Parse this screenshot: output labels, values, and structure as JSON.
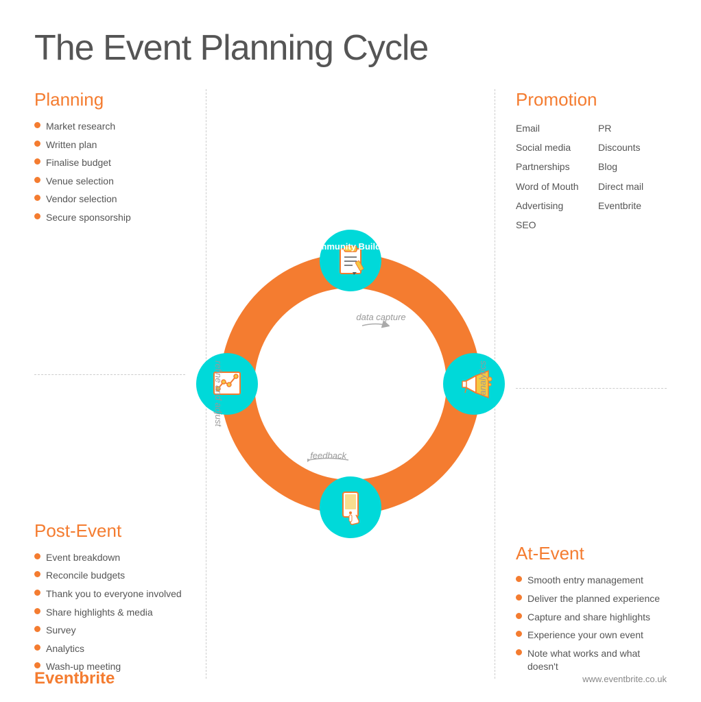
{
  "title": "The Event Planning Cycle",
  "planning": {
    "label": "Planning",
    "items": [
      "Market research",
      "Written plan",
      "Finalise budget",
      "Venue selection",
      "Vendor selection",
      "Secure sponsorship"
    ]
  },
  "post_event": {
    "label": "Post-Event",
    "items": [
      "Event breakdown",
      "Reconcile budgets",
      "Thank you to everyone involved",
      "Share highlights & media",
      "Survey",
      "Analytics",
      "Wash-up meeting"
    ]
  },
  "promotion": {
    "label": "Promotion",
    "col1": [
      "Email",
      "Social media",
      "Partnerships",
      "Word of Mouth",
      "Advertising",
      "SEO"
    ],
    "col2": [
      "PR",
      "Discounts",
      "Blog",
      "Direct mail",
      "Eventbrite",
      ""
    ]
  },
  "at_event": {
    "label": "At-Event",
    "items": [
      "Smooth entry management",
      "Deliver the planned experience",
      "Capture and share highlights",
      "Experience your own event",
      "Note what works and what doesn't"
    ]
  },
  "cycle": {
    "community_building": "Community Building",
    "data_capture": "data capture",
    "analytics": "analytics",
    "feedback": "feedback",
    "refine_adjust": "refine and adjust"
  },
  "footer": {
    "brand": "Eventbrite",
    "website": "www.eventbrite.co.uk"
  }
}
